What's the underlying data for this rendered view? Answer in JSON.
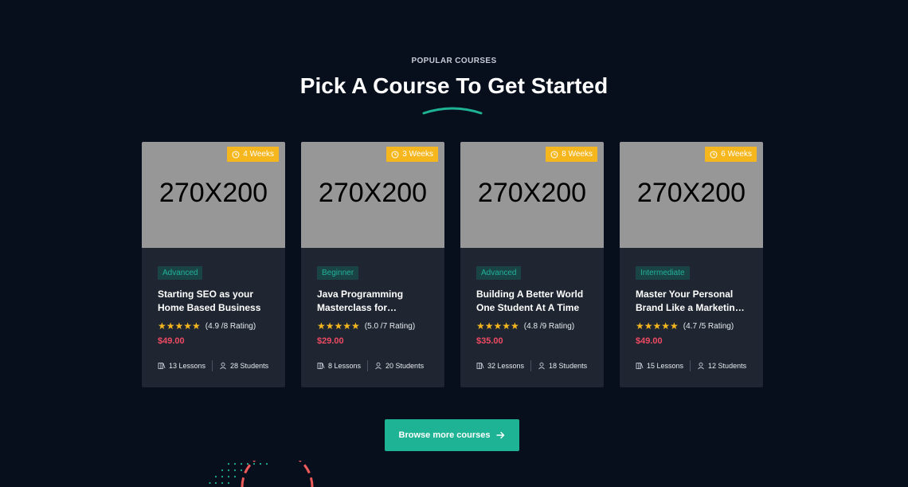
{
  "section": {
    "eyebrow": "POPULAR COURSES",
    "title": "Pick A Course To Get Started"
  },
  "colors": {
    "background": "#070e1c",
    "card": "#1f2631",
    "accent": "#1eb394",
    "badge": "#f6b61e",
    "price": "#ee4a62"
  },
  "courses": [
    {
      "duration": "4 Weeks",
      "thumbnail": "270X200",
      "level": "Advanced",
      "title": "Starting SEO as your Home Based Business",
      "stars": "★★★★★",
      "rating": "(4.9 /8 Rating)",
      "price": "$49.00",
      "lessons": "13 Lessons",
      "students": "28 Students"
    },
    {
      "duration": "3 Weeks",
      "thumbnail": "270X200",
      "level": "Beginner",
      "title": "Java Programming Masterclass for Software Developers",
      "stars": "★★★★★",
      "rating": "(5.0 /7 Rating)",
      "price": "$29.00",
      "lessons": "8 Lessons",
      "students": "20 Students"
    },
    {
      "duration": "8 Weeks",
      "thumbnail": "270X200",
      "level": "Advanced",
      "title": "Building A Better World One Student At A Time",
      "stars": "★★★★★",
      "rating": "(4.8 /9 Rating)",
      "price": "$35.00",
      "lessons": "32 Lessons",
      "students": "18 Students"
    },
    {
      "duration": "6 Weeks",
      "thumbnail": "270X200",
      "level": "Intermediate",
      "title": "Master Your Personal Brand Like a Marketing Pro",
      "stars": "★★★★★",
      "rating": "(4.7 /5 Rating)",
      "price": "$49.00",
      "lessons": "15 Lessons",
      "students": "12 Students"
    }
  ],
  "browse_button": {
    "label": "Browse more courses",
    "icon": "arrow-right-icon"
  }
}
